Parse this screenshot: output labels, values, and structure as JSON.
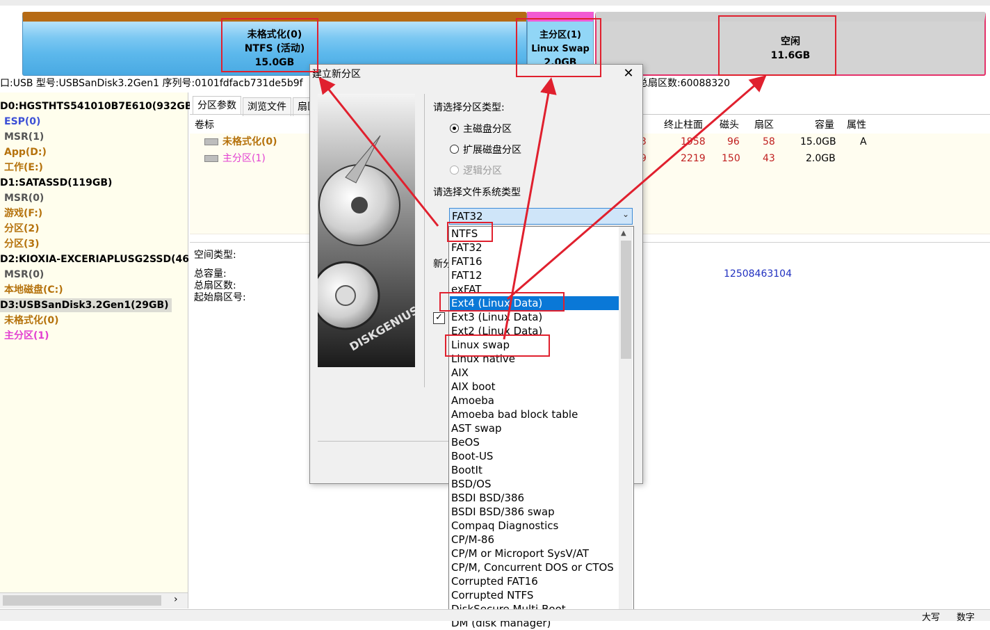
{
  "disk_map": {
    "partitions": [
      {
        "line1": "未格式化(0)",
        "line2": "NTFS (活动)",
        "line3": "15.0GB"
      },
      {
        "line1": "主分区(1)",
        "line2": "Linux Swap",
        "line3": "2.0GB"
      },
      {
        "line1": "空闲",
        "line2": "11.6GB"
      }
    ]
  },
  "disk_info": {
    "left": "口:USB  型号:USBSanDisk3.2Gen1  序列号:0101fdfacb731de5b9f",
    "right": "总扇区数:60088320"
  },
  "tree": {
    "items": [
      {
        "label": "D0:HGSTHTS541010B7E610(932GB)",
        "color": "#000000"
      },
      {
        "label": "ESP(0)",
        "color": "#3b4fd6"
      },
      {
        "label": "MSR(1)",
        "color": "#555555"
      },
      {
        "label": "App(D:)",
        "color": "#b5720c"
      },
      {
        "label": "工作(E:)",
        "color": "#b5720c"
      },
      {
        "label": "D1:SATASSD(119GB)",
        "color": "#000000"
      },
      {
        "label": "MSR(0)",
        "color": "#555555"
      },
      {
        "label": "游戏(F:)",
        "color": "#b5720c"
      },
      {
        "label": "分区(2)",
        "color": "#b5720c"
      },
      {
        "label": "分区(3)",
        "color": "#b5720c"
      },
      {
        "label": "D2:KIOXIA-EXCERIAPLUSG2SSD(466",
        "color": "#000000"
      },
      {
        "label": "MSR(0)",
        "color": "#555555"
      },
      {
        "label": "本地磁盘(C:)",
        "color": "#b5720c"
      },
      {
        "label": "D3:USBSanDisk3.2Gen1(29GB)",
        "color": "#000000"
      },
      {
        "label": "未格式化(0)",
        "color": "#b5720c"
      },
      {
        "label": "主分区(1)",
        "color": "#e23fd1"
      }
    ]
  },
  "tabs": [
    "分区参数",
    "浏览文件",
    "扇区"
  ],
  "table": {
    "headers": {
      "label": "卷标",
      "end_cyl": "终止柱面",
      "heads": "磁头",
      "sectors": "扇区",
      "capacity": "容量",
      "attr": "属性"
    },
    "rows": [
      {
        "name": "未格式化(0)",
        "clip": "3",
        "end_cyl": "1958",
        "heads": "96",
        "sectors": "58",
        "capacity": "15.0GB",
        "attr": "A",
        "color": "#b5720c"
      },
      {
        "name": "主分区(1)",
        "clip": "9",
        "end_cyl": "2219",
        "heads": "150",
        "sectors": "43",
        "capacity": "2.0GB",
        "attr": "",
        "color": "#e23fd1"
      }
    ]
  },
  "info": {
    "space_type": "空间类型:",
    "total_capacity": "总容量:",
    "total_sectors": "总扇区数:",
    "start_sector": "起始扇区号:",
    "value": "12508463104"
  },
  "dialog": {
    "title": "建立新分区",
    "close": "✕",
    "partition_type_label": "请选择分区类型:",
    "radio_primary": "主磁盘分区",
    "radio_extended": "扩展磁盘分区",
    "radio_logical": "逻辑分区",
    "fs_label": "请选择文件系统类型",
    "fs_selected": "FAT32",
    "new_clip": "新分",
    "options": [
      "NTFS",
      "FAT32",
      "FAT16",
      "FAT12",
      "exFAT",
      "Ext4 (Linux Data)",
      "Ext3 (Linux Data)",
      "Ext2 (Linux Data)",
      "Linux swap",
      "Linux native",
      "AIX",
      "AIX boot",
      "Amoeba",
      "Amoeba bad block table",
      "AST swap",
      "BeOS",
      "Boot-US",
      "BootIt",
      "BSD/OS",
      "BSDI BSD/386",
      "BSDI BSD/386 swap",
      "Compaq Diagnostics",
      "CP/M-86",
      "CP/M or Microport SysV/AT",
      "CP/M, Concurrent DOS or CTOS",
      "Corrupted FAT16",
      "Corrupted NTFS",
      "DiskSecure Multi-Boot",
      "DM (disk manager)"
    ],
    "highlighted": "Ext4 (Linux Data)",
    "brand": "DISKGENIUS"
  },
  "status": {
    "a": "大写",
    "b": "数字"
  }
}
